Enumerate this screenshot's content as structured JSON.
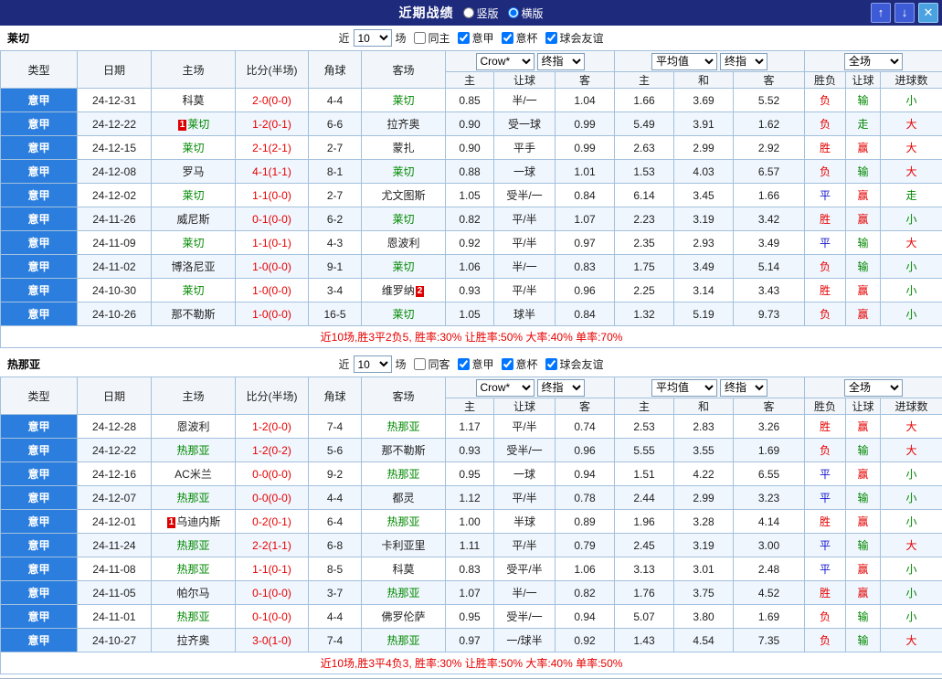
{
  "titlebar": {
    "title": "近期战绩",
    "radios": [
      {
        "label": "竖版",
        "checked": false
      },
      {
        "label": "横版",
        "checked": true
      }
    ],
    "buttons": {
      "up": "↑",
      "down": "↓",
      "close": "✕"
    }
  },
  "columns": {
    "type": "类型",
    "date": "日期",
    "home": "主场",
    "score": "比分(半场)",
    "corner": "角球",
    "away": "客场",
    "bookmaker_select": "Crow*",
    "final_select": "终指",
    "average_select": "平均值",
    "final_select2": "终指",
    "fulltime_select": "全场",
    "sub": [
      "主",
      "让球",
      "客",
      "主",
      "和",
      "客",
      "胜负",
      "让球",
      "进球数"
    ]
  },
  "colors": {
    "titlebar_bg": "#1e2b7d",
    "league_cell_bg": "#2b7ede",
    "focal_team_green": "#008800",
    "win_red": "#e60000",
    "lose_green": "#008800",
    "draw_blue": "#1515cc",
    "summary_red": "#e60000"
  },
  "sections": [
    {
      "team": "莱切",
      "controls": {
        "prefix": "近",
        "count": "10",
        "suffix": "场",
        "checkboxes": [
          {
            "label": "同主",
            "checked": false
          },
          {
            "label": "意甲",
            "checked": true
          },
          {
            "label": "意杯",
            "checked": true
          },
          {
            "label": "球会友谊",
            "checked": true
          }
        ]
      },
      "rows": [
        {
          "league": "意甲",
          "date": "24-12-31",
          "home": {
            "name": "科莫",
            "focal": false
          },
          "score": "2-0(0-0)",
          "corner": "4-4",
          "away": {
            "name": "莱切",
            "focal": true
          },
          "odds1": [
            "0.85",
            "半/一",
            "1.04"
          ],
          "odds2": [
            "1.66",
            "3.69",
            "5.52"
          ],
          "results": [
            {
              "text": "负",
              "color": "red"
            },
            {
              "text": "输",
              "color": "green"
            },
            {
              "text": "小",
              "color": "green"
            }
          ]
        },
        {
          "league": "意甲",
          "date": "24-12-22",
          "home": {
            "name": "莱切",
            "focal": true,
            "badge": {
              "text": "1",
              "pos": "before"
            }
          },
          "score": "1-2(0-1)",
          "corner": "6-6",
          "away": {
            "name": "拉齐奥",
            "focal": false
          },
          "odds1": [
            "0.90",
            "受一球",
            "0.99"
          ],
          "odds2": [
            "5.49",
            "3.91",
            "1.62"
          ],
          "results": [
            {
              "text": "负",
              "color": "red"
            },
            {
              "text": "走",
              "color": "green"
            },
            {
              "text": "大",
              "color": "red"
            }
          ]
        },
        {
          "league": "意甲",
          "date": "24-12-15",
          "home": {
            "name": "莱切",
            "focal": true
          },
          "score": "2-1(2-1)",
          "corner": "2-7",
          "away": {
            "name": "蒙扎",
            "focal": false
          },
          "odds1": [
            "0.90",
            "平手",
            "0.99"
          ],
          "odds2": [
            "2.63",
            "2.99",
            "2.92"
          ],
          "results": [
            {
              "text": "胜",
              "color": "red"
            },
            {
              "text": "赢",
              "color": "red"
            },
            {
              "text": "大",
              "color": "red"
            }
          ]
        },
        {
          "league": "意甲",
          "date": "24-12-08",
          "home": {
            "name": "罗马",
            "focal": false
          },
          "score": "4-1(1-1)",
          "corner": "8-1",
          "away": {
            "name": "莱切",
            "focal": true
          },
          "odds1": [
            "0.88",
            "一球",
            "1.01"
          ],
          "odds2": [
            "1.53",
            "4.03",
            "6.57"
          ],
          "results": [
            {
              "text": "负",
              "color": "red"
            },
            {
              "text": "输",
              "color": "green"
            },
            {
              "text": "大",
              "color": "red"
            }
          ]
        },
        {
          "league": "意甲",
          "date": "24-12-02",
          "home": {
            "name": "莱切",
            "focal": true
          },
          "score": "1-1(0-0)",
          "corner": "2-7",
          "away": {
            "name": "尤文图斯",
            "focal": false
          },
          "odds1": [
            "1.05",
            "受半/一",
            "0.84"
          ],
          "odds2": [
            "6.14",
            "3.45",
            "1.66"
          ],
          "results": [
            {
              "text": "平",
              "color": "blue"
            },
            {
              "text": "赢",
              "color": "red"
            },
            {
              "text": "走",
              "color": "green"
            }
          ]
        },
        {
          "league": "意甲",
          "date": "24-11-26",
          "home": {
            "name": "威尼斯",
            "focal": false
          },
          "score": "0-1(0-0)",
          "corner": "6-2",
          "away": {
            "name": "莱切",
            "focal": true
          },
          "odds1": [
            "0.82",
            "平/半",
            "1.07"
          ],
          "odds2": [
            "2.23",
            "3.19",
            "3.42"
          ],
          "results": [
            {
              "text": "胜",
              "color": "red"
            },
            {
              "text": "赢",
              "color": "red"
            },
            {
              "text": "小",
              "color": "green"
            }
          ]
        },
        {
          "league": "意甲",
          "date": "24-11-09",
          "home": {
            "name": "莱切",
            "focal": true
          },
          "score": "1-1(0-1)",
          "corner": "4-3",
          "away": {
            "name": "恩波利",
            "focal": false
          },
          "odds1": [
            "0.92",
            "平/半",
            "0.97"
          ],
          "odds2": [
            "2.35",
            "2.93",
            "3.49"
          ],
          "results": [
            {
              "text": "平",
              "color": "blue"
            },
            {
              "text": "输",
              "color": "green"
            },
            {
              "text": "大",
              "color": "red"
            }
          ]
        },
        {
          "league": "意甲",
          "date": "24-11-02",
          "home": {
            "name": "博洛尼亚",
            "focal": false
          },
          "score": "1-0(0-0)",
          "corner": "9-1",
          "away": {
            "name": "莱切",
            "focal": true
          },
          "odds1": [
            "1.06",
            "半/一",
            "0.83"
          ],
          "odds2": [
            "1.75",
            "3.49",
            "5.14"
          ],
          "results": [
            {
              "text": "负",
              "color": "red"
            },
            {
              "text": "输",
              "color": "green"
            },
            {
              "text": "小",
              "color": "green"
            }
          ]
        },
        {
          "league": "意甲",
          "date": "24-10-30",
          "home": {
            "name": "莱切",
            "focal": true
          },
          "score": "1-0(0-0)",
          "corner": "3-4",
          "away": {
            "name": "维罗纳",
            "focal": false,
            "badge": {
              "text": "2",
              "pos": "after"
            }
          },
          "odds1": [
            "0.93",
            "平/半",
            "0.96"
          ],
          "odds2": [
            "2.25",
            "3.14",
            "3.43"
          ],
          "results": [
            {
              "text": "胜",
              "color": "red"
            },
            {
              "text": "赢",
              "color": "red"
            },
            {
              "text": "小",
              "color": "green"
            }
          ]
        },
        {
          "league": "意甲",
          "date": "24-10-26",
          "home": {
            "name": "那不勒斯",
            "focal": false
          },
          "score": "1-0(0-0)",
          "corner": "16-5",
          "away": {
            "name": "莱切",
            "focal": true
          },
          "odds1": [
            "1.05",
            "球半",
            "0.84"
          ],
          "odds2": [
            "1.32",
            "5.19",
            "9.73"
          ],
          "results": [
            {
              "text": "负",
              "color": "red"
            },
            {
              "text": "赢",
              "color": "red"
            },
            {
              "text": "小",
              "color": "green"
            }
          ]
        }
      ],
      "summary": "近10场,胜3平2负5, 胜率:30% 让胜率:50% 大率:40% 单率:70%"
    },
    {
      "team": "热那亚",
      "controls": {
        "prefix": "近",
        "count": "10",
        "suffix": "场",
        "checkboxes": [
          {
            "label": "同客",
            "checked": false
          },
          {
            "label": "意甲",
            "checked": true
          },
          {
            "label": "意杯",
            "checked": true
          },
          {
            "label": "球会友谊",
            "checked": true
          }
        ]
      },
      "rows": [
        {
          "league": "意甲",
          "date": "24-12-28",
          "home": {
            "name": "恩波利",
            "focal": false
          },
          "score": "1-2(0-0)",
          "corner": "7-4",
          "away": {
            "name": "热那亚",
            "focal": true
          },
          "odds1": [
            "1.17",
            "平/半",
            "0.74"
          ],
          "odds2": [
            "2.53",
            "2.83",
            "3.26"
          ],
          "results": [
            {
              "text": "胜",
              "color": "red"
            },
            {
              "text": "赢",
              "color": "red"
            },
            {
              "text": "大",
              "color": "red"
            }
          ]
        },
        {
          "league": "意甲",
          "date": "24-12-22",
          "home": {
            "name": "热那亚",
            "focal": true
          },
          "score": "1-2(0-2)",
          "corner": "5-6",
          "away": {
            "name": "那不勒斯",
            "focal": false
          },
          "odds1": [
            "0.93",
            "受半/一",
            "0.96"
          ],
          "odds2": [
            "5.55",
            "3.55",
            "1.69"
          ],
          "results": [
            {
              "text": "负",
              "color": "red"
            },
            {
              "text": "输",
              "color": "green"
            },
            {
              "text": "大",
              "color": "red"
            }
          ]
        },
        {
          "league": "意甲",
          "date": "24-12-16",
          "home": {
            "name": "AC米兰",
            "focal": false
          },
          "score": "0-0(0-0)",
          "corner": "9-2",
          "away": {
            "name": "热那亚",
            "focal": true
          },
          "odds1": [
            "0.95",
            "一球",
            "0.94"
          ],
          "odds2": [
            "1.51",
            "4.22",
            "6.55"
          ],
          "results": [
            {
              "text": "平",
              "color": "blue"
            },
            {
              "text": "赢",
              "color": "red"
            },
            {
              "text": "小",
              "color": "green"
            }
          ]
        },
        {
          "league": "意甲",
          "date": "24-12-07",
          "home": {
            "name": "热那亚",
            "focal": true
          },
          "score": "0-0(0-0)",
          "corner": "4-4",
          "away": {
            "name": "都灵",
            "focal": false
          },
          "odds1": [
            "1.12",
            "平/半",
            "0.78"
          ],
          "odds2": [
            "2.44",
            "2.99",
            "3.23"
          ],
          "results": [
            {
              "text": "平",
              "color": "blue"
            },
            {
              "text": "输",
              "color": "green"
            },
            {
              "text": "小",
              "color": "green"
            }
          ]
        },
        {
          "league": "意甲",
          "date": "24-12-01",
          "home": {
            "name": "乌迪内斯",
            "focal": false,
            "badge": {
              "text": "1",
              "pos": "before"
            }
          },
          "score": "0-2(0-1)",
          "corner": "6-4",
          "away": {
            "name": "热那亚",
            "focal": true
          },
          "odds1": [
            "1.00",
            "半球",
            "0.89"
          ],
          "odds2": [
            "1.96",
            "3.28",
            "4.14"
          ],
          "results": [
            {
              "text": "胜",
              "color": "red"
            },
            {
              "text": "赢",
              "color": "red"
            },
            {
              "text": "小",
              "color": "green"
            }
          ]
        },
        {
          "league": "意甲",
          "date": "24-11-24",
          "home": {
            "name": "热那亚",
            "focal": true
          },
          "score": "2-2(1-1)",
          "corner": "6-8",
          "away": {
            "name": "卡利亚里",
            "focal": false
          },
          "odds1": [
            "1.11",
            "平/半",
            "0.79"
          ],
          "odds2": [
            "2.45",
            "3.19",
            "3.00"
          ],
          "results": [
            {
              "text": "平",
              "color": "blue"
            },
            {
              "text": "输",
              "color": "green"
            },
            {
              "text": "大",
              "color": "red"
            }
          ]
        },
        {
          "league": "意甲",
          "date": "24-11-08",
          "home": {
            "name": "热那亚",
            "focal": true
          },
          "score": "1-1(0-1)",
          "corner": "8-5",
          "away": {
            "name": "科莫",
            "focal": false
          },
          "odds1": [
            "0.83",
            "受平/半",
            "1.06"
          ],
          "odds2": [
            "3.13",
            "3.01",
            "2.48"
          ],
          "results": [
            {
              "text": "平",
              "color": "blue"
            },
            {
              "text": "赢",
              "color": "red"
            },
            {
              "text": "小",
              "color": "green"
            }
          ]
        },
        {
          "league": "意甲",
          "date": "24-11-05",
          "home": {
            "name": "帕尔马",
            "focal": false
          },
          "score": "0-1(0-0)",
          "corner": "3-7",
          "away": {
            "name": "热那亚",
            "focal": true
          },
          "odds1": [
            "1.07",
            "半/一",
            "0.82"
          ],
          "odds2": [
            "1.76",
            "3.75",
            "4.52"
          ],
          "results": [
            {
              "text": "胜",
              "color": "red"
            },
            {
              "text": "赢",
              "color": "red"
            },
            {
              "text": "小",
              "color": "green"
            }
          ]
        },
        {
          "league": "意甲",
          "date": "24-11-01",
          "home": {
            "name": "热那亚",
            "focal": true
          },
          "score": "0-1(0-0)",
          "corner": "4-4",
          "away": {
            "name": "佛罗伦萨",
            "focal": false
          },
          "odds1": [
            "0.95",
            "受半/一",
            "0.94"
          ],
          "odds2": [
            "5.07",
            "3.80",
            "1.69"
          ],
          "results": [
            {
              "text": "负",
              "color": "red"
            },
            {
              "text": "输",
              "color": "green"
            },
            {
              "text": "小",
              "color": "green"
            }
          ]
        },
        {
          "league": "意甲",
          "date": "24-10-27",
          "home": {
            "name": "拉齐奥",
            "focal": false
          },
          "score": "3-0(1-0)",
          "corner": "7-4",
          "away": {
            "name": "热那亚",
            "focal": true
          },
          "odds1": [
            "0.97",
            "一/球半",
            "0.92"
          ],
          "odds2": [
            "1.43",
            "4.54",
            "7.35"
          ],
          "results": [
            {
              "text": "负",
              "color": "red"
            },
            {
              "text": "输",
              "color": "green"
            },
            {
              "text": "大",
              "color": "red"
            }
          ]
        }
      ],
      "summary": "近10场,胜3平4负3, 胜率:30% 让胜率:50% 大率:40% 单率:50%"
    }
  ]
}
